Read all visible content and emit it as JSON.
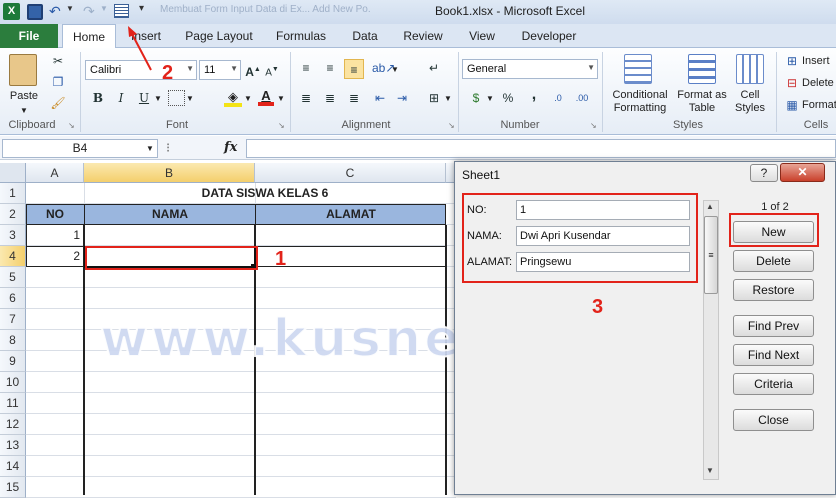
{
  "window": {
    "title": "Book1.xlsx  -  Microsoft Excel",
    "ghost_tabs": "Membuat Form Input Data di Ex...   Add New Po..."
  },
  "ribbon": {
    "file_tab": "File",
    "tabs": [
      "Home",
      "Insert",
      "Page Layout",
      "Formulas",
      "Data",
      "Review",
      "View",
      "Developer"
    ],
    "clipboard": {
      "paste": "Paste",
      "label": "Clipboard"
    },
    "font": {
      "name": "Calibri",
      "size": "11",
      "bold": "B",
      "italic": "I",
      "underline": "U",
      "color_letter": "A",
      "label": "Font"
    },
    "alignment": {
      "label": "Alignment"
    },
    "number": {
      "format": "General",
      "currency": "$",
      "percent": "%",
      "comma": ",",
      "label": "Number"
    },
    "styles": {
      "conditional": "Conditional Formatting",
      "format_table": "Format as Table",
      "cell_styles": "Cell Styles",
      "label": "Styles"
    },
    "cells": {
      "insert": "Insert",
      "delete": "Delete",
      "format": "Format",
      "label": "Cells"
    }
  },
  "formula_bar": {
    "name_box": "B4",
    "fx": "fx",
    "value": ""
  },
  "sheet": {
    "columns": [
      "A",
      "B",
      "C"
    ],
    "rows": [
      "1",
      "2",
      "3",
      "4",
      "5",
      "6",
      "7",
      "8",
      "9",
      "10",
      "11",
      "12",
      "13",
      "14",
      "15"
    ],
    "title": "DATA SISWA KELAS 6",
    "headers": [
      "NO",
      "NAMA",
      "ALAMAT"
    ],
    "data": [
      [
        "1",
        "",
        ""
      ],
      [
        "2",
        "",
        ""
      ]
    ]
  },
  "dialog": {
    "title": "Sheet1",
    "help": "?",
    "close": "✕",
    "record": "1 of 2",
    "fields": [
      {
        "label": "NO:",
        "value": "1"
      },
      {
        "label": "NAMA:",
        "value": "Dwi Apri Kusendar"
      },
      {
        "label": "ALAMAT:",
        "value": "Pringsewu"
      }
    ],
    "buttons": [
      "New",
      "Delete",
      "Restore",
      "Find Prev",
      "Find Next",
      "Criteria",
      "Close"
    ]
  },
  "annotations": {
    "one": "1",
    "two": "2",
    "three": "3"
  },
  "watermark": "www.kusnendar.web.id",
  "colors": {
    "header_fill": "#9ab6de",
    "annotation": "#e2231a",
    "file_tab": "#2b7d3d"
  }
}
